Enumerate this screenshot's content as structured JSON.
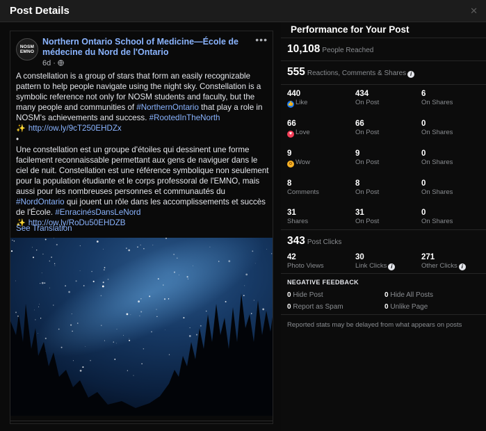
{
  "window": {
    "title": "Post Details",
    "close_icon": "close-icon"
  },
  "post": {
    "avatar_lines": [
      "NOSM",
      "EMNO"
    ],
    "author": "Northern Ontario School of Medicine—École de médecine du Nord de l'Ontario",
    "timestamp": "6d · ",
    "audience_icon": "globe-icon",
    "more_label": "•••",
    "en_text_1": "A constellation is a group of stars that form an easily recognizable pattern to help people navigate using the night sky. Constellation is a symbolic reference not only for NOSM students and faculty, but the many people and communities of ",
    "en_tag_1": "#NorthernOntario",
    "en_text_2": " that play a role in NOSM's achievements and success. ",
    "en_tag_2": "#RootedInTheNorth",
    "en_link": "http://ow.ly/9cT250EHDZx",
    "bullet": "•",
    "fr_text_1": "Une constellation est un groupe d'étoiles qui dessinent une forme facilement reconnaissable permettant aux gens de naviguer dans le ciel de nuit. Constellation est une référence symbolique non seulement pour la population étudiante et le corps professoral de l'EMNO, mais aussi pour les nombreuses personnes et communautés du ",
    "fr_tag_1": "#NordOntario",
    "fr_text_2": " qui jouent un rôle dans les accomplissements et succès de l'École. ",
    "fr_tag_2": "#EnracinésDansLeNord",
    "fr_link": "http://ow.ly/RoDu50EHDZB",
    "sparkle": "✨",
    "see_translation": "See Translation"
  },
  "performance": {
    "title": "Performance for Your Post",
    "reached": {
      "value": "10,108",
      "label": "People Reached"
    },
    "reactions": {
      "value": "555",
      "label": "Reactions, Comments & Shares"
    },
    "rows": [
      {
        "value": "440",
        "label": "Like",
        "emoji": "like-icon",
        "on_post": "434",
        "on_post_label": "On Post",
        "on_shares": "6",
        "on_shares_label": "On Shares"
      },
      {
        "value": "66",
        "label": "Love",
        "emoji": "love-icon",
        "on_post": "66",
        "on_post_label": "On Post",
        "on_shares": "0",
        "on_shares_label": "On Shares"
      },
      {
        "value": "9",
        "label": "Wow",
        "emoji": "wow-icon",
        "on_post": "9",
        "on_post_label": "On Post",
        "on_shares": "0",
        "on_shares_label": "On Shares"
      },
      {
        "value": "8",
        "label": "Comments",
        "on_post": "8",
        "on_post_label": "On Post",
        "on_shares": "0",
        "on_shares_label": "On Shares"
      },
      {
        "value": "31",
        "label": "Shares",
        "on_post": "31",
        "on_post_label": "On Post",
        "on_shares": "0",
        "on_shares_label": "On Shares"
      }
    ],
    "clicks": {
      "value": "343",
      "label": "Post Clicks"
    },
    "click_breakdown": [
      {
        "value": "42",
        "label": "Photo Views"
      },
      {
        "value": "30",
        "label": "Link Clicks"
      },
      {
        "value": "271",
        "label": "Other Clicks"
      }
    ],
    "negative": {
      "title": "NEGATIVE FEEDBACK",
      "hide_post": {
        "value": "0",
        "label": "Hide Post"
      },
      "hide_all": {
        "value": "0",
        "label": "Hide All Posts"
      },
      "report_spam": {
        "value": "0",
        "label": "Report as Spam"
      },
      "unlike_page": {
        "value": "0",
        "label": "Unlike Page"
      }
    },
    "footnote": "Reported stats may be delayed from what appears on posts"
  },
  "colors": {
    "link": "#8ab4ff",
    "like": "#1877f2",
    "love": "#f33e58",
    "wow": "#f7b125"
  }
}
